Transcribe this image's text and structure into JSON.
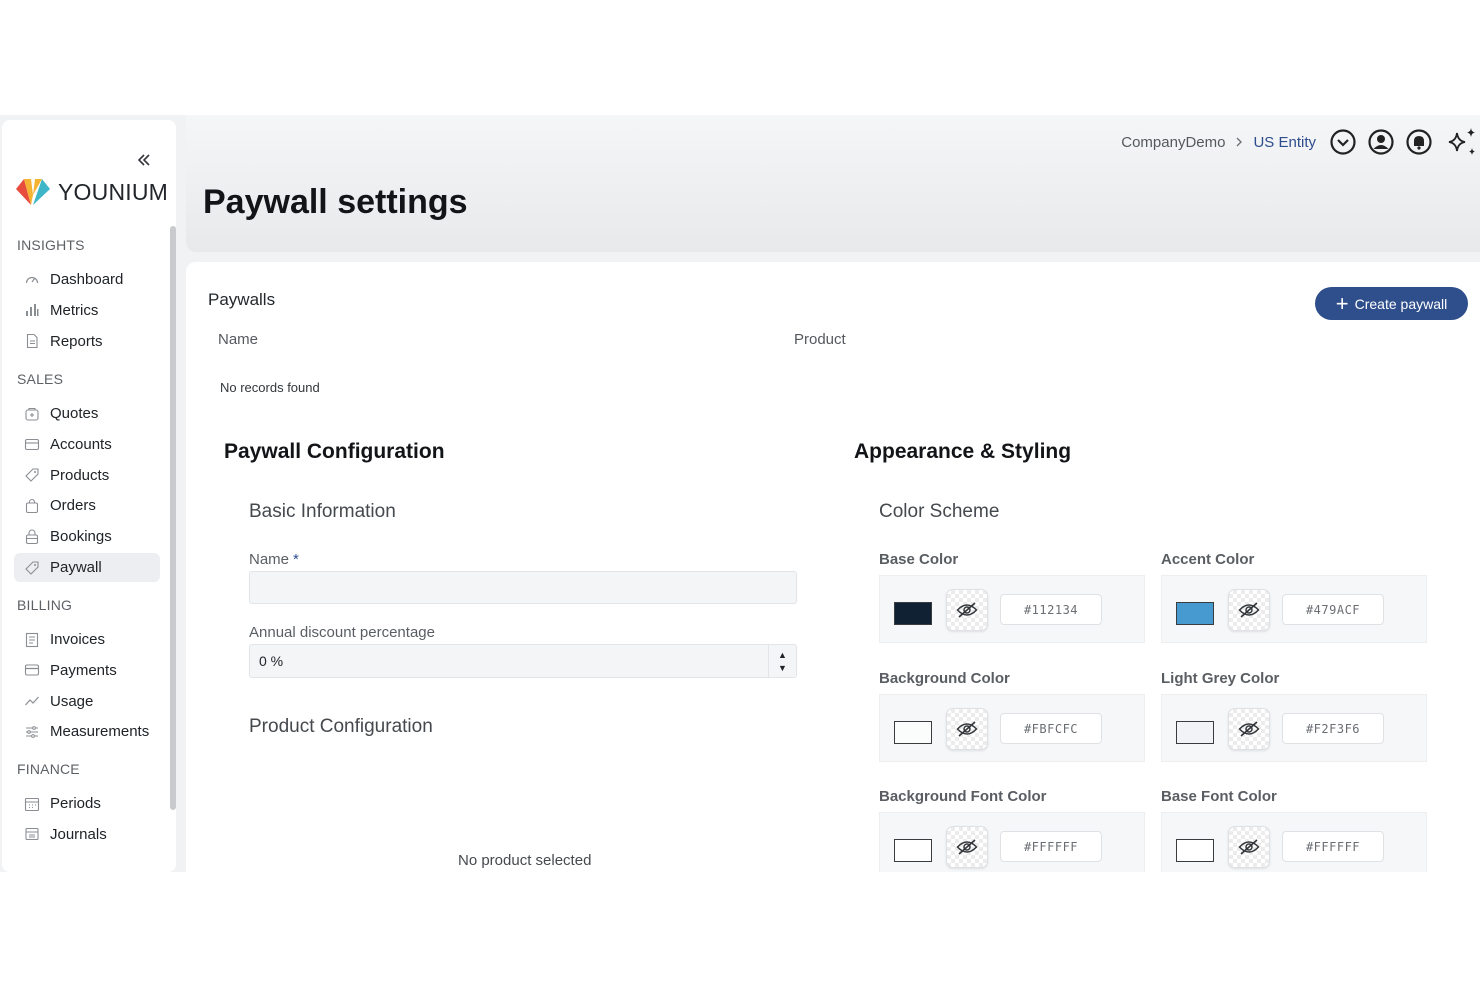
{
  "brand": {
    "name": "YOUNIUM"
  },
  "sidebar": {
    "sections": [
      {
        "title": "INSIGHTS",
        "items": [
          {
            "label": "Dashboard",
            "icon": "dashboard-icon"
          },
          {
            "label": "Metrics",
            "icon": "bar-chart-icon"
          },
          {
            "label": "Reports",
            "icon": "document-icon"
          }
        ]
      },
      {
        "title": "SALES",
        "items": [
          {
            "label": "Quotes",
            "icon": "quote-icon"
          },
          {
            "label": "Accounts",
            "icon": "wallet-icon"
          },
          {
            "label": "Products",
            "icon": "tag-icon"
          },
          {
            "label": "Orders",
            "icon": "bag-icon"
          },
          {
            "label": "Bookings",
            "icon": "lock-bag-icon"
          },
          {
            "label": "Paywall",
            "icon": "tag-icon",
            "active": true
          }
        ]
      },
      {
        "title": "BILLING",
        "items": [
          {
            "label": "Invoices",
            "icon": "invoice-icon"
          },
          {
            "label": "Payments",
            "icon": "card-icon"
          },
          {
            "label": "Usage",
            "icon": "trend-icon"
          },
          {
            "label": "Measurements",
            "icon": "sliders-icon"
          }
        ]
      },
      {
        "title": "FINANCE",
        "items": [
          {
            "label": "Periods",
            "icon": "calendar-icon"
          },
          {
            "label": "Journals",
            "icon": "journal-icon"
          }
        ]
      }
    ]
  },
  "header": {
    "title": "Paywall settings",
    "breadcrumb": {
      "company": "CompanyDemo",
      "entity": "US Entity"
    }
  },
  "paywalls": {
    "title": "Paywalls",
    "create_label": "Create paywall",
    "columns": [
      "Name",
      "Product"
    ],
    "empty_text": "No records found"
  },
  "config": {
    "title": "Paywall Configuration",
    "basic_title": "Basic Information",
    "name_label": "Name",
    "name_required": "*",
    "name_value": "",
    "discount_label": "Annual discount percentage",
    "discount_value": "0 %",
    "product_title": "Product Configuration",
    "no_product": "No product selected"
  },
  "appearance": {
    "title": "Appearance & Styling",
    "scheme_title": "Color Scheme",
    "colors": [
      {
        "label": "Base Color",
        "hex": "#112134",
        "swatch": "#112134"
      },
      {
        "label": "Accent Color",
        "hex": "#479ACF",
        "swatch": "#479ACF"
      },
      {
        "label": "Background Color",
        "hex": "#FBFCFC",
        "swatch": "#FBFCFC"
      },
      {
        "label": "Light Grey Color",
        "hex": "#F2F3F6",
        "swatch": "#F2F3F6"
      },
      {
        "label": "Background Font Color",
        "hex": "#FFFFFF",
        "swatch": "#FFFFFF"
      },
      {
        "label": "Base Font Color",
        "hex": "#FFFFFF",
        "swatch": "#FFFFFF"
      }
    ]
  }
}
